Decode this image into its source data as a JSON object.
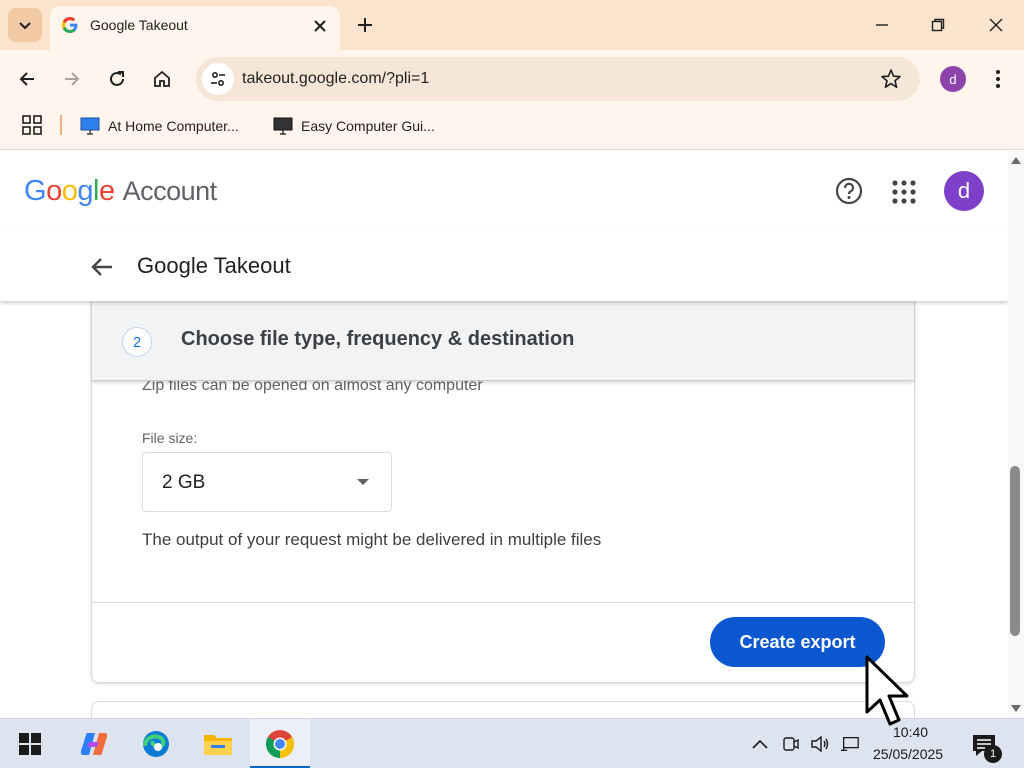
{
  "browser": {
    "tab_title": "Google Takeout",
    "url": "takeout.google.com/?pli=1",
    "profile_initial": "d",
    "bookmarks": [
      {
        "label": "At Home Computer...",
        "icon": "monitor-icon"
      },
      {
        "label": "Easy Computer Gui...",
        "icon": "monitor-icon"
      }
    ]
  },
  "header": {
    "logo_letters": [
      "G",
      "o",
      "o",
      "g",
      "l",
      "e"
    ],
    "logo_suffix": "Account",
    "avatar_initial": "d",
    "icons": [
      "help-icon",
      "apps-grid-icon"
    ]
  },
  "subheader": {
    "title": "Google Takeout",
    "back_icon": "arrow-left-icon"
  },
  "step": {
    "number": "2",
    "title": "Choose file type, frequency & destination",
    "zip_note": "Zip files can be opened on almost any computer",
    "file_size_label": "File size:",
    "file_size_value": "2 GB",
    "output_note": "The output of your request might be delivered in multiple files",
    "create_button": "Create export"
  },
  "taskbar": {
    "apps": [
      "start-icon",
      "copilot-icon",
      "edge-icon",
      "file-explorer-icon",
      "chrome-icon"
    ],
    "active_app": "chrome-icon",
    "time": "10:40",
    "date": "25/05/2025",
    "notification_count": "1"
  },
  "colors": {
    "titlebar": "#fbe3cd",
    "toolbar": "#fff5ec",
    "primary_button": "#0b57d0",
    "avatar": "#7e3fc9"
  }
}
